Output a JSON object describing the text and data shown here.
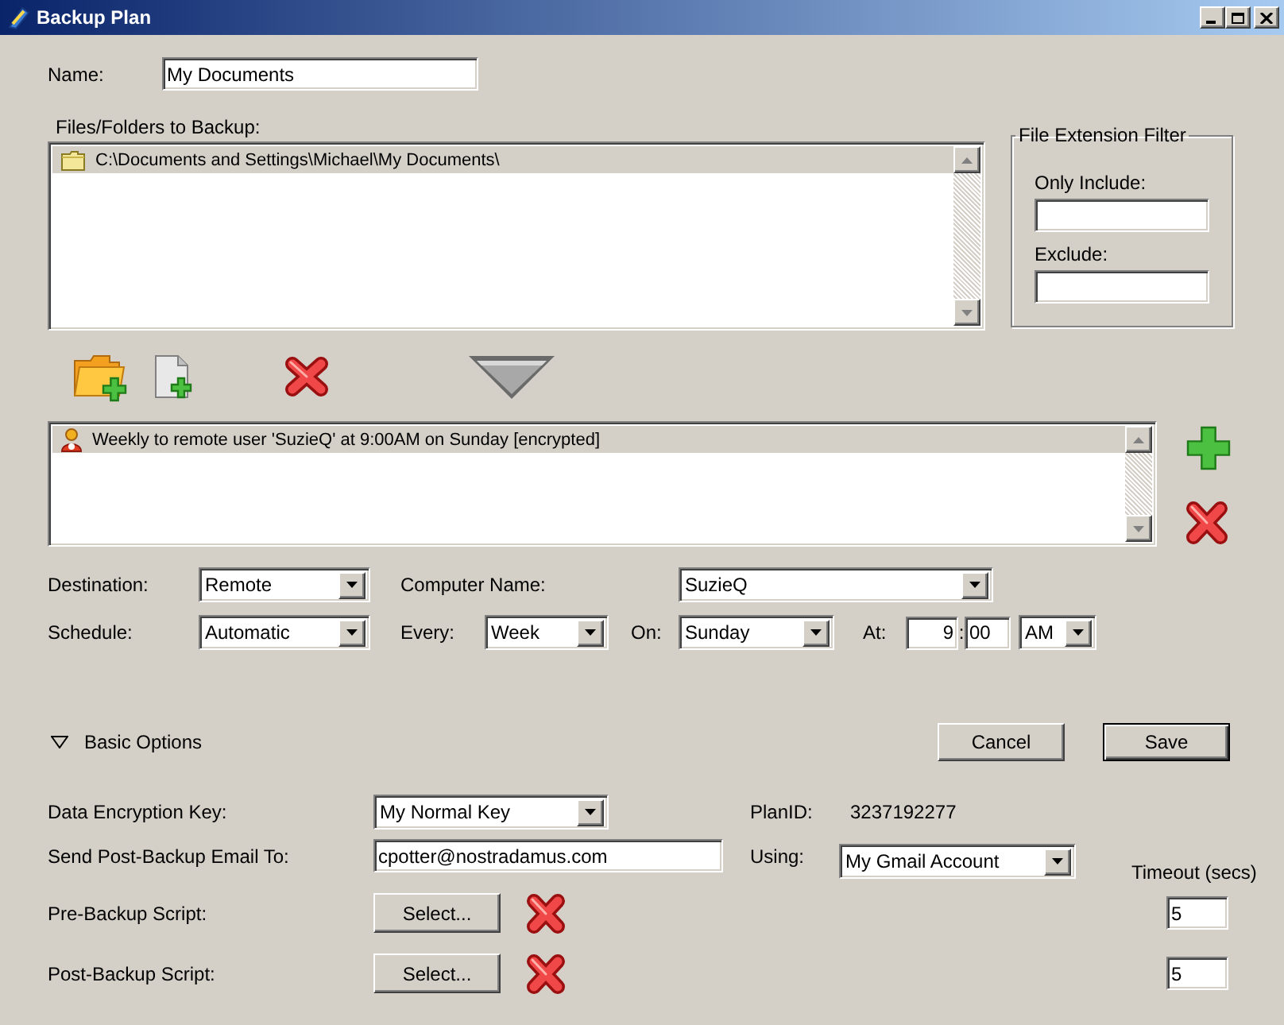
{
  "window": {
    "title": "Backup Plan"
  },
  "name": {
    "label": "Name:",
    "value": "My Documents"
  },
  "files": {
    "label": "Files/Folders to Backup:",
    "items": [
      {
        "kind": "folder",
        "text": "C:\\Documents and Settings\\Michael\\My Documents\\",
        "selected": true
      }
    ]
  },
  "extension_filter": {
    "title": "File Extension Filter",
    "only_include": {
      "label": "Only Include:"
    },
    "exclude": {
      "label": "Exclude:"
    }
  },
  "plans": {
    "items": [
      {
        "kind": "user",
        "text": "Weekly to remote user 'SuzieQ' at 9:00AM on Sunday [encrypted]",
        "selected": true
      }
    ]
  },
  "destination": {
    "label": "Destination:",
    "value": "Remote"
  },
  "computer_name": {
    "label": "Computer Name:",
    "value": "SuzieQ"
  },
  "schedule": {
    "label": "Schedule:",
    "value": "Automatic"
  },
  "every": {
    "label": "Every:",
    "value": "Week"
  },
  "on": {
    "label": "On:",
    "value": "Sunday"
  },
  "at": {
    "label": "At:",
    "hour": "9",
    "separator": ":",
    "minute": "00",
    "period": "AM"
  },
  "basic_options": {
    "label": "Basic Options",
    "expanded": true
  },
  "buttons": [
    {
      "label": "Cancel",
      "default": false
    },
    {
      "label": "Save",
      "default": true
    }
  ],
  "encryption_key": {
    "label": "Data Encryption Key:",
    "value": "My Normal Key"
  },
  "plan_id": {
    "label": "PlanID:",
    "value": "3237192277"
  },
  "email": {
    "label": "Send Post-Backup Email To:",
    "value": "cpotter@nostradamus.com"
  },
  "using": {
    "label": "Using:",
    "value": "My Gmail Account"
  },
  "timeout_label": "Timeout (secs)",
  "scripts": [
    {
      "label": "Pre-Backup Script:",
      "button": "Select...",
      "timeout": "5"
    },
    {
      "label": "Post-Backup Script:",
      "button": "Select...",
      "timeout": "5"
    }
  ]
}
